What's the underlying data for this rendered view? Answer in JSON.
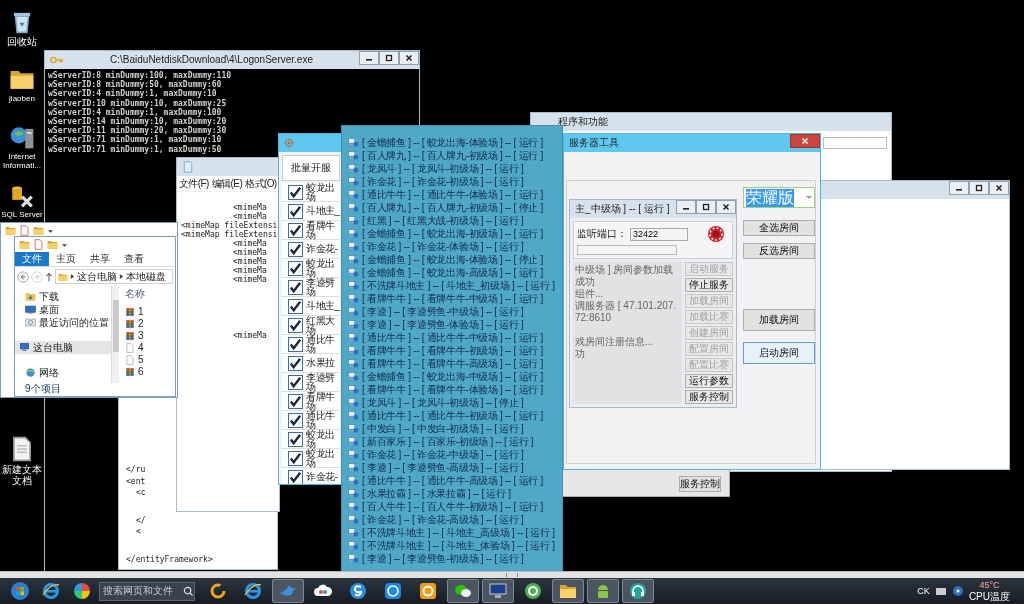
{
  "desktop_icons": [
    {
      "label": "回收站",
      "kind": "recycle"
    },
    {
      "label": "jiaoben",
      "kind": "folder"
    },
    {
      "label": "Internet Informati...",
      "kind": "iis"
    },
    {
      "label": "SQL Server",
      "kind": "sql"
    },
    {
      "label": "新建文本文档",
      "kind": "document"
    }
  ],
  "console": {
    "title": "C:\\BaiduNetdiskDownload\\4\\LogonServer.exe",
    "lines": [
      "wServerID:8 minDummy:100, maxDummy:110",
      "wServerID:8 minDummy:50, maxDummy:60",
      "wServerID:4 minDummy:1, maxDummy:10",
      "wServerID:10 minDummy:10, maxDummy:25",
      "wServerID:4 minDummy:1, maxDummy:100",
      "wServerID:14 minDummy:10, maxDummy:20",
      "wServerID:11 minDummy:20, maxDummy:30",
      "wServerID:71 minDummy:1, maxDummy:10",
      "wServerID:71 minDummy:1, maxDummy:50"
    ]
  },
  "programs_window": {
    "title": "程序和功能"
  },
  "service_window": {
    "button": "服务控制"
  },
  "xml_window": {
    "lines": [
      {
        "text": "</ru",
        "indented": false,
        "gap_before": false
      },
      {
        "text": "<ent",
        "indented": false,
        "gap_before": false
      },
      {
        "text": "<c",
        "indented": true,
        "gap_before": false
      },
      {
        "text": "</",
        "indented": true,
        "gap_before": true
      },
      {
        "text": "<",
        "indented": true,
        "gap_before": false
      },
      {
        "text": "</entityFramework>",
        "indented": false,
        "gap_before": true
      }
    ]
  },
  "notepad": {
    "menu": [
      "文件(F)",
      "编辑(E)",
      "格式(O)"
    ],
    "lines": [
      {
        "text": "<mimeMa",
        "indented": true,
        "gap_before": false
      },
      {
        "text": "<mimeMa",
        "indented": true,
        "gap_before": false
      },
      {
        "text": "<mimeMap fileExtensi",
        "indented": false,
        "gap_before": false
      },
      {
        "text": "<mimeMap fileExtensi",
        "indented": false,
        "gap_before": false
      },
      {
        "text": "<mimeMa",
        "indented": true,
        "gap_before": false
      },
      {
        "text": "<mimeMa",
        "indented": true,
        "gap_before": false
      },
      {
        "text": "<mimeMa",
        "indented": true,
        "gap_before": false
      },
      {
        "text": "<mimeMa",
        "indented": true,
        "gap_before": false
      },
      {
        "text": "<mimeMa",
        "indented": true,
        "gap_before": false
      },
      {
        "text": "<mimeMa",
        "indented": true,
        "gap_before": true
      }
    ]
  },
  "explorer": {
    "tabs": [
      {
        "label": "文件",
        "selected": true
      },
      {
        "label": "主页",
        "selected": false
      },
      {
        "label": "共享",
        "selected": false
      },
      {
        "label": "查看",
        "selected": false
      }
    ],
    "path": [
      "这台电脑",
      "本地磁盘"
    ],
    "nav_groups": [
      [
        {
          "label": "下载",
          "kind": "download",
          "selected": false
        },
        {
          "label": "桌面",
          "kind": "desktop",
          "selected": false
        },
        {
          "label": "最近访问的位置",
          "kind": "recent",
          "selected": false
        }
      ],
      [
        {
          "label": "这台电脑",
          "kind": "computer",
          "selected": true
        }
      ],
      [
        {
          "label": "网络",
          "kind": "network",
          "selected": false
        }
      ]
    ],
    "column": "名称",
    "files": [
      {
        "name": "1",
        "kind": "archive"
      },
      {
        "name": "2",
        "kind": "archive"
      },
      {
        "name": "3",
        "kind": "archive"
      },
      {
        "name": "4",
        "kind": "file"
      },
      {
        "name": "5",
        "kind": "file"
      },
      {
        "name": "6",
        "kind": "archive"
      }
    ],
    "status": "9个项目"
  },
  "server_tool": {
    "title": "服务器工具",
    "edition": "荣耀版",
    "buttons": [
      {
        "label": "全选房间",
        "focused": false
      },
      {
        "label": "反选房间",
        "focused": false
      },
      {
        "label": "加载房间",
        "focused": false
      },
      {
        "label": "启动房间",
        "focused": true
      }
    ],
    "room_dialog": {
      "title": "主_中级场 ] -- [ 运行 ]",
      "port_label": "监听端口：",
      "port": "32422",
      "log": [
        {
          "text": "中级场 ] 房间参数加载成功",
          "gap_before": false
        },
        {
          "text": "组件...",
          "gap_before": false
        },
        {
          "text": "调服务器 [ 47.101.207.72:8610",
          "gap_before": false
        },
        {
          "text": "戏房间注册信息...",
          "gap_before": true
        },
        {
          "text": "功",
          "gap_before": false
        }
      ],
      "buttons": [
        {
          "label": "启动服务",
          "disabled": true
        },
        {
          "label": "停止服务",
          "disabled": false
        },
        {
          "label": "加载房间",
          "disabled": true
        },
        {
          "label": "加载比赛",
          "disabled": true
        },
        {
          "label": "创建房间",
          "disabled": true
        },
        {
          "label": "配置房间",
          "disabled": true
        },
        {
          "label": "配置比赛",
          "disabled": true
        },
        {
          "label": "运行参数",
          "disabled": false
        },
        {
          "label": "服务控制",
          "disabled": false
        }
      ]
    }
  },
  "batch_window": {
    "tab": "批量开服",
    "rooms": [
      {
        "lines": [
          "蛟龙出",
          "场"
        ],
        "checked": true
      },
      {
        "lines": [
          "斗地主_"
        ],
        "checked": true
      },
      {
        "lines": [
          "看牌牛",
          "场"
        ],
        "checked": true
      },
      {
        "lines": [
          "诈金花-"
        ],
        "checked": true
      },
      {
        "lines": [
          "蛟龙出",
          "场"
        ],
        "checked": true
      },
      {
        "lines": [
          "李逵劈",
          "场"
        ],
        "checked": true
      },
      {
        "lines": [
          "斗地主_"
        ],
        "checked": true
      },
      {
        "lines": [
          "红黑大",
          "场"
        ],
        "checked": true
      },
      {
        "lines": [
          "通比牛",
          "场"
        ],
        "checked": true
      },
      {
        "lines": [
          "水果拉"
        ],
        "checked": true
      },
      {
        "lines": [
          "李逵劈",
          "场"
        ],
        "checked": true
      },
      {
        "lines": [
          "看牌牛",
          "场"
        ],
        "checked": true
      },
      {
        "lines": [
          "通比牛",
          "场"
        ],
        "checked": true
      },
      {
        "lines": [
          "蛟龙出",
          "场"
        ],
        "checked": true
      },
      {
        "lines": [
          "蛟龙出",
          "场"
        ],
        "checked": true
      },
      {
        "lines": [
          "诈金花-"
        ],
        "checked": true
      }
    ]
  },
  "room_list": {
    "rows": [
      "[ 金蟾捕鱼 ] -- [ 蛟龙出海-体验场 ] -- [ 运行 ]",
      "[ 百人牌九 ] -- [ 百人牌九-初级场 ] -- [ 运行 ]",
      "[ 龙凤斗 ] -- [ 龙凤斗-初级场 ] -- [ 运行 ]",
      "[ 诈金花 ] -- [ 诈金花-初级场 ] -- [ 运行 ]",
      "[ 通比牛牛 ] -- [ 通比牛牛-体验场 ] -- [ 运行 ]",
      "[ 百人牌九 ] -- [ 百人牌九-初级场 ] -- [ 停止 ]",
      "[ 红黑 ] -- [ 红黑大战-初级场 ] -- [ 运行 ]",
      "[ 金蟾捕鱼 ] -- [ 蛟龙出海-初级场 ] -- [ 运行 ]",
      "[ 诈金花 ] -- [ 诈金花-体验场 ] -- [ 运行 ]",
      "[ 金蟾捕鱼 ] -- [ 蛟龙出海-体验场 ] -- [ 停止 ]",
      "[ 金蟾捕鱼 ] -- [ 蛟龙出海-高级场 ] -- [ 运行 ]",
      "[ 不洗牌斗地主 ] -- [ 斗地主_初级场 ] -- [ 运行 ]",
      "[ 看牌牛牛 ] -- [ 看牌牛牛-中级场 ] -- [ 运行 ]",
      "[ 李逵 ] -- [ 李逵劈鱼-中级场 ] -- [ 运行 ]",
      "[ 李逵 ] -- [ 李逵劈鱼-体验场 ] -- [ 运行 ]",
      "[ 通比牛牛 ] -- [ 通比牛牛-中级场 ] -- [ 运行 ]",
      "[ 看牌牛牛 ] -- [ 看牌牛牛-初级场 ] -- [ 运行 ]",
      "[ 看牌牛牛 ] -- [ 看牌牛牛-高级场 ] -- [ 运行 ]",
      "[ 金蟾捕鱼 ] -- [ 蛟龙出海-中级场 ] -- [ 运行 ]",
      "[ 看牌牛牛 ] -- [ 看牌牛牛-体验场 ] -- [ 运行 ]",
      "[ 龙凤斗 ] -- [ 龙凤斗-初级场 ] -- [ 停止 ]",
      "[ 通比牛牛 ] -- [ 通比牛牛-初级场 ] -- [ 运行 ]",
      "[ 中发白 ] -- [ 中发白-初级场 ] -- [ 运行 ]",
      "[ 新百家乐 ] -- [ 百家乐-初级场 ] -- [ 运行 ]",
      "[ 诈金花 ] -- [ 诈金花-中级场 ] -- [ 运行 ]",
      "[ 李逵 ] -- [ 李逵劈鱼-高级场 ] -- [ 运行 ]",
      "[ 通比牛牛 ] -- [ 通比牛牛-高级场 ] -- [ 运行 ]",
      "[ 水果拉霸 ] -- [ 水果拉霸 ] -- [ 运行 ]",
      "[ 百人牛牛 ] -- [ 百人牛牛-初级场 ] -- [ 运行 ]",
      "[ 诈金花 ] -- [ 诈金花-高级场 ] -- [ 运行 ]",
      "[ 不洗牌斗地主 ] -- [ 斗地主_高级场 ] -- [ 运行 ]",
      "[ 不洗牌斗地主 ] -- [ 斗地主_体验场 ] -- [ 运行 ]",
      "[ 李逵 ] -- [ 李逵劈鱼-初级场 ] -- [ 运行 ]"
    ]
  },
  "taskbar": {
    "pinned": [
      {
        "kind": "start"
      },
      {
        "kind": "browser"
      },
      {
        "kind": "pinwheel"
      }
    ],
    "search_placeholder": "搜索网页和文件",
    "apps": [
      {
        "kind": "ring",
        "active": false
      },
      {
        "kind": "browser",
        "active": false
      },
      {
        "kind": "bird",
        "active": true
      },
      {
        "kind": "cloud",
        "active": false
      },
      {
        "kind": "swirl",
        "active": false
      },
      {
        "kind": "kbadge",
        "active": false
      },
      {
        "kind": "orange",
        "active": false
      },
      {
        "kind": "chat",
        "active": true
      },
      {
        "kind": "monitor",
        "active": true
      },
      {
        "kind": "egreen",
        "active": false
      },
      {
        "kind": "folder",
        "active": true
      },
      {
        "kind": "robot",
        "active": true
      },
      {
        "kind": "headset",
        "active": true
      }
    ],
    "tray": {
      "label": "CK",
      "temperature": "45°C",
      "temperature_label": "CPU温度"
    }
  }
}
